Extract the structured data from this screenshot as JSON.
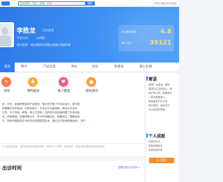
{
  "site": {
    "search_placeholder": "搜索医院、医生、疾病、科室",
    "search_button": "搜索",
    "top_links": "| 本站已通过安全验证"
  },
  "doctor": {
    "name": "李胜龙",
    "title": "主任医师",
    "dept_label": "专业方向：",
    "dept_value": "心内科",
    "hospital_label": "就诊医院：",
    "hospital_value": "南方医科大学南方医院",
    "hospital_suffix": "肝胆外科",
    "scores": [
      {
        "label": "综合推荐热度",
        "value": "4.8"
      },
      {
        "label": "累计访问",
        "value": "39121"
      }
    ]
  },
  "nav": {
    "tabs": [
      "首页",
      "简介",
      "门诊信息",
      "评价",
      "问诊",
      "科普号",
      "感心礼物"
    ],
    "active_index": 0
  },
  "actions": [
    {
      "label": "问诊",
      "color": "#ff7a45",
      "icon": "consult-icon",
      "glyph": "✎"
    },
    {
      "label": "预约挂号",
      "color": "#ffa940",
      "icon": "calendar-icon",
      "glyph": "✚"
    },
    {
      "label": "私人医生",
      "color": "#ff5c7a",
      "icon": "person-icon",
      "glyph": "♥"
    },
    {
      "label": "团队接诊",
      "color": "#ff9c3a",
      "icon": "team-icon",
      "glyph": "●"
    }
  ],
  "intro": {
    "lines": [
      "肝、外伤、胆道等等各种严重病例，擅长的开展了不仅经治疗，部分因",
      "效果确诊后的疾病，诊断及转诊，手术治疗及高难度，微创手术治疗，",
      "主任、长江学者、教授、博士生导师，在肝胆外科领域积累了丰富经验",
      "术、肝脏移植、胆道镜等诊疗，肝内外胆管结石、胆囊结石、胰腺疾病",
      "疗，熟练掌握各类手术及先进的腹腔镜技术，擅长治疗各种胆道疾病。"
    ],
    "expand_label": "展开"
  },
  "notice": "以上信息由患者、医院和本站共同维护提供，非医生本人提供，仅供参考，如有问题请联系我们反馈修改。",
  "schedule": {
    "title": "出诊时间",
    "more": "查看全部出诊时间 >"
  },
  "sidebar": {
    "msg_head": "寄语",
    "message_lines": [
      "感谢广大患者，重拾",
      "健康与生活的信心，是",
      "我们的心愿。希望我们",
      "一起为健康奋斗。",
      "患者朋友们可以来",
      "预约咨询，我会尽力",
      "为大家提供帮助。"
    ],
    "achieve_head": "个人成就",
    "achieve_lines": [
      "年度好大夫",
      "患者信赖医生",
      "优秀科普专家"
    ],
    "follow_button": "关注医生"
  }
}
